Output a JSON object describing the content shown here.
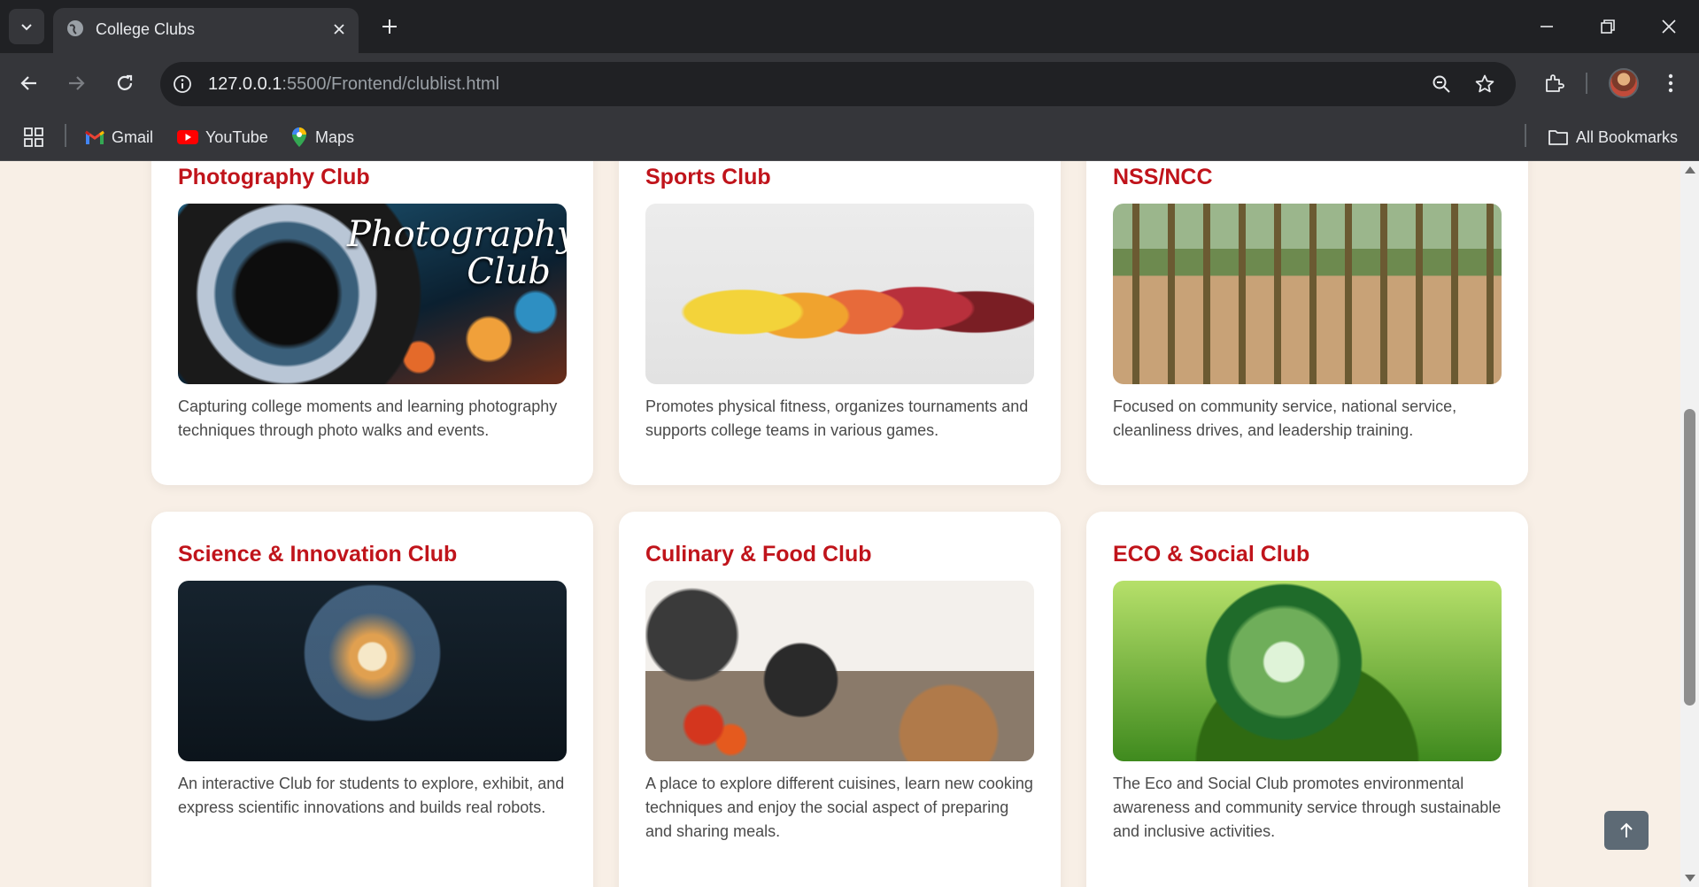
{
  "browser": {
    "tab_title": "College Clubs",
    "url_host": "127.0.0.1",
    "url_path": ":5500/Frontend/clublist.html",
    "bookmarks": [
      {
        "label": "Gmail",
        "icon": "gmail-icon"
      },
      {
        "label": "YouTube",
        "icon": "youtube-icon"
      },
      {
        "label": "Maps",
        "icon": "maps-icon"
      }
    ],
    "all_bookmarks": "All Bookmarks"
  },
  "clubs": [
    {
      "title": "Photography Club",
      "description": "Capturing college moments and learning photography techniques through photo walks and events.",
      "image": "photography-club-image",
      "image_caption": "Photography Club"
    },
    {
      "title": "Sports Club",
      "description": "Promotes physical fitness, organizes tournaments and supports college teams in various games.",
      "image": "sports-club-image"
    },
    {
      "title": "NSS/NCC",
      "description": "Focused on community service, national service, cleanliness drives, and leadership training.",
      "image": "nss-ncc-image"
    },
    {
      "title": "Science & Innovation Club",
      "description": "An interactive Club for students to explore, exhibit, and express scientific innovations and builds real robots.",
      "image": "science-club-image"
    },
    {
      "title": "Culinary & Food Club",
      "description": "A place to explore different cuisines, learn new cooking techniques and enjoy the social aspect of preparing and sharing meals.",
      "image": "food-club-image"
    },
    {
      "title": "ECO & Social Club",
      "description": "The Eco and Social Club promotes environmental awareness and community service through sustainable and inclusive activities.",
      "image": "eco-club-image"
    }
  ],
  "colors": {
    "title_red": "#c0141b",
    "page_bg": "#f8efe6",
    "chrome_dark": "#202124",
    "chrome_toolbar": "#35363a"
  }
}
